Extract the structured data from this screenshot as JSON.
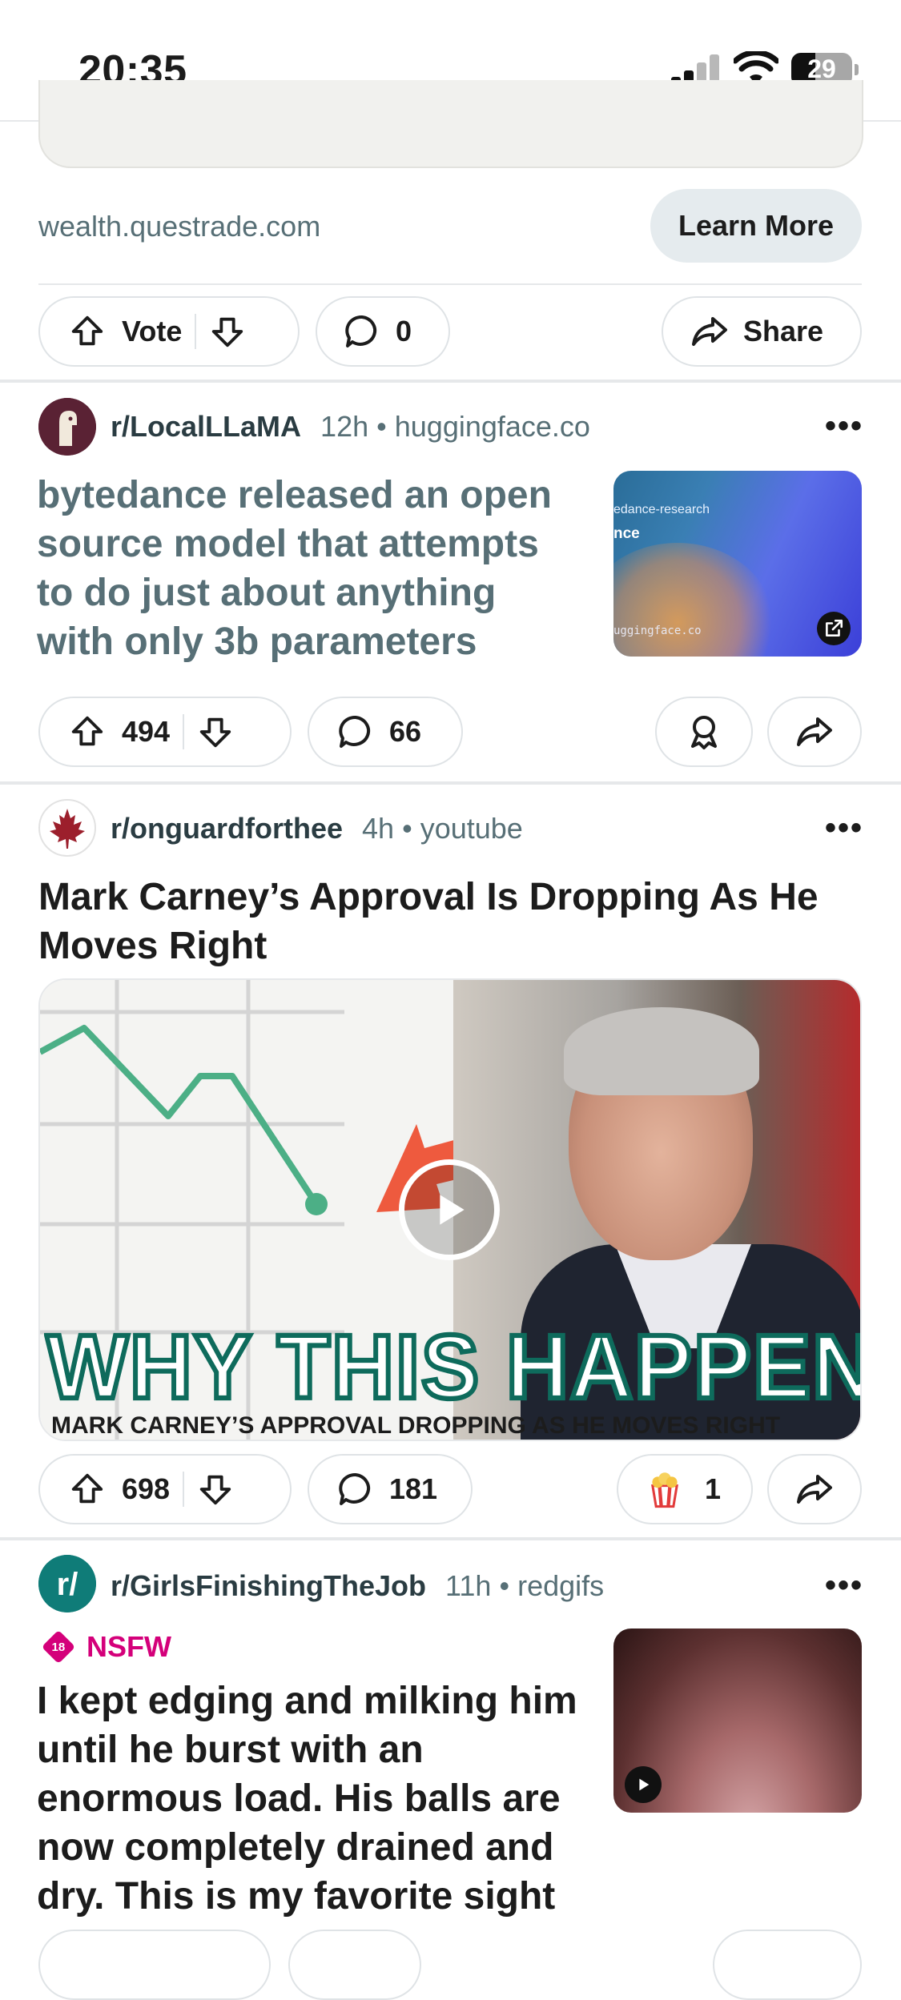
{
  "status_bar": {
    "time": "20:35",
    "battery": "29"
  },
  "ad": {
    "domain": "wealth.questrade.com",
    "cta": "Learn More",
    "vote_label": "Vote",
    "comments": "0",
    "share_label": "Share"
  },
  "posts": [
    {
      "subreddit": "r/LocalLLaMA",
      "age": "12h",
      "source": "huggingface.co",
      "title_lines": [
        "bytedance released an open",
        "source model that attempts",
        "to do just about anything",
        "with only 3b parameters"
      ],
      "upvotes": "494",
      "comments": "66",
      "thumb_text": {
        "line1": "edance-research",
        "line2": "nce",
        "line3": "uggingface.co"
      }
    },
    {
      "subreddit": "r/onguardforthee",
      "age": "4h",
      "source": "youtube",
      "title_lines": [
        "Mark Carney’s Approval Is Dropping As He",
        "Moves Right"
      ],
      "video_caption_big": "WHY THIS HAPPENED",
      "video_caption_small": "MARK CARNEY’S APPROVAL DROPPING AS HE MOVES RIGHT",
      "upvotes": "698",
      "comments": "181",
      "awards": "1"
    },
    {
      "subreddit": "r/GirlsFinishingTheJob",
      "age": "11h",
      "source": "redgifs",
      "nsfw_badge": "18",
      "nsfw_label": "NSFW",
      "title_lines": [
        "I kept edging and milking him",
        "until he burst with an",
        "enormous load. His balls are",
        "now completely drained and",
        "dry. This is my favorite sight"
      ]
    }
  ],
  "colors": {
    "nsfw": "#d4007a",
    "meta": "#576f76",
    "chart_line": "#4caf86"
  }
}
